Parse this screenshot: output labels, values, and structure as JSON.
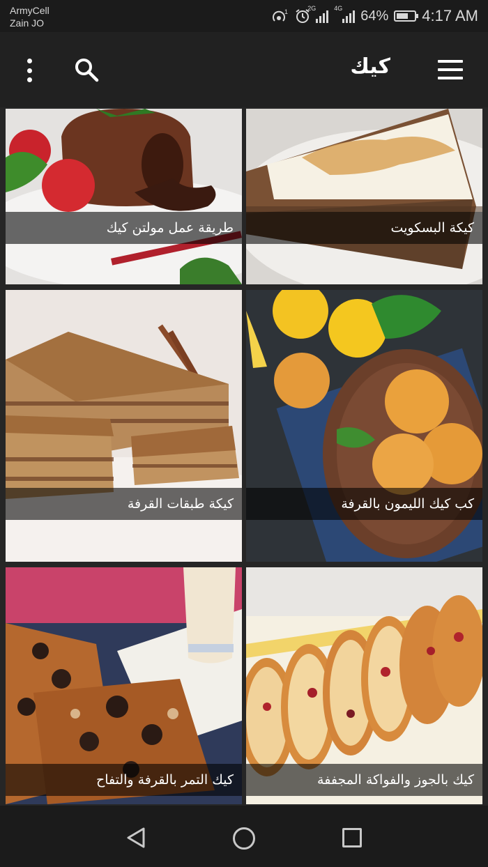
{
  "status_bar": {
    "carrier_line1": "ArmyCell",
    "carrier_line2": "Zain JO",
    "icons": [
      "hotspot-icon",
      "alarm-icon",
      "signal-2g-icon",
      "signal-4g-icon",
      "battery-saver-icon"
    ],
    "net1": "2G",
    "net2": "4G",
    "battery_percent": "64%",
    "battery_level": 0.64,
    "time": "4:17 AM"
  },
  "app_bar": {
    "title": "كيك",
    "menu_icon": "hamburger-icon",
    "search_icon": "search-icon",
    "more_icon": "more-vert-icon"
  },
  "recipes": [
    {
      "title": "كيكة البسكويت"
    },
    {
      "title": "طريقة عمل مولتن كيك"
    },
    {
      "title": "كب كيك الليمون بالقرفة"
    },
    {
      "title": "كيكة طبقات القرفة"
    },
    {
      "title": "كيك بالجوز والفواكة المجففة"
    },
    {
      "title": "كيك التمر بالقرفة والتفاح"
    }
  ],
  "nav_bar": {
    "back_icon": "back-triangle-icon",
    "home_icon": "home-circle-icon",
    "recent_icon": "recent-apps-square-icon"
  },
  "colors": {
    "background": "#262626",
    "app_bar": "#212121",
    "status_bar": "#1b1b1b",
    "caption_overlay": "rgba(0,0,0,0.58)"
  }
}
